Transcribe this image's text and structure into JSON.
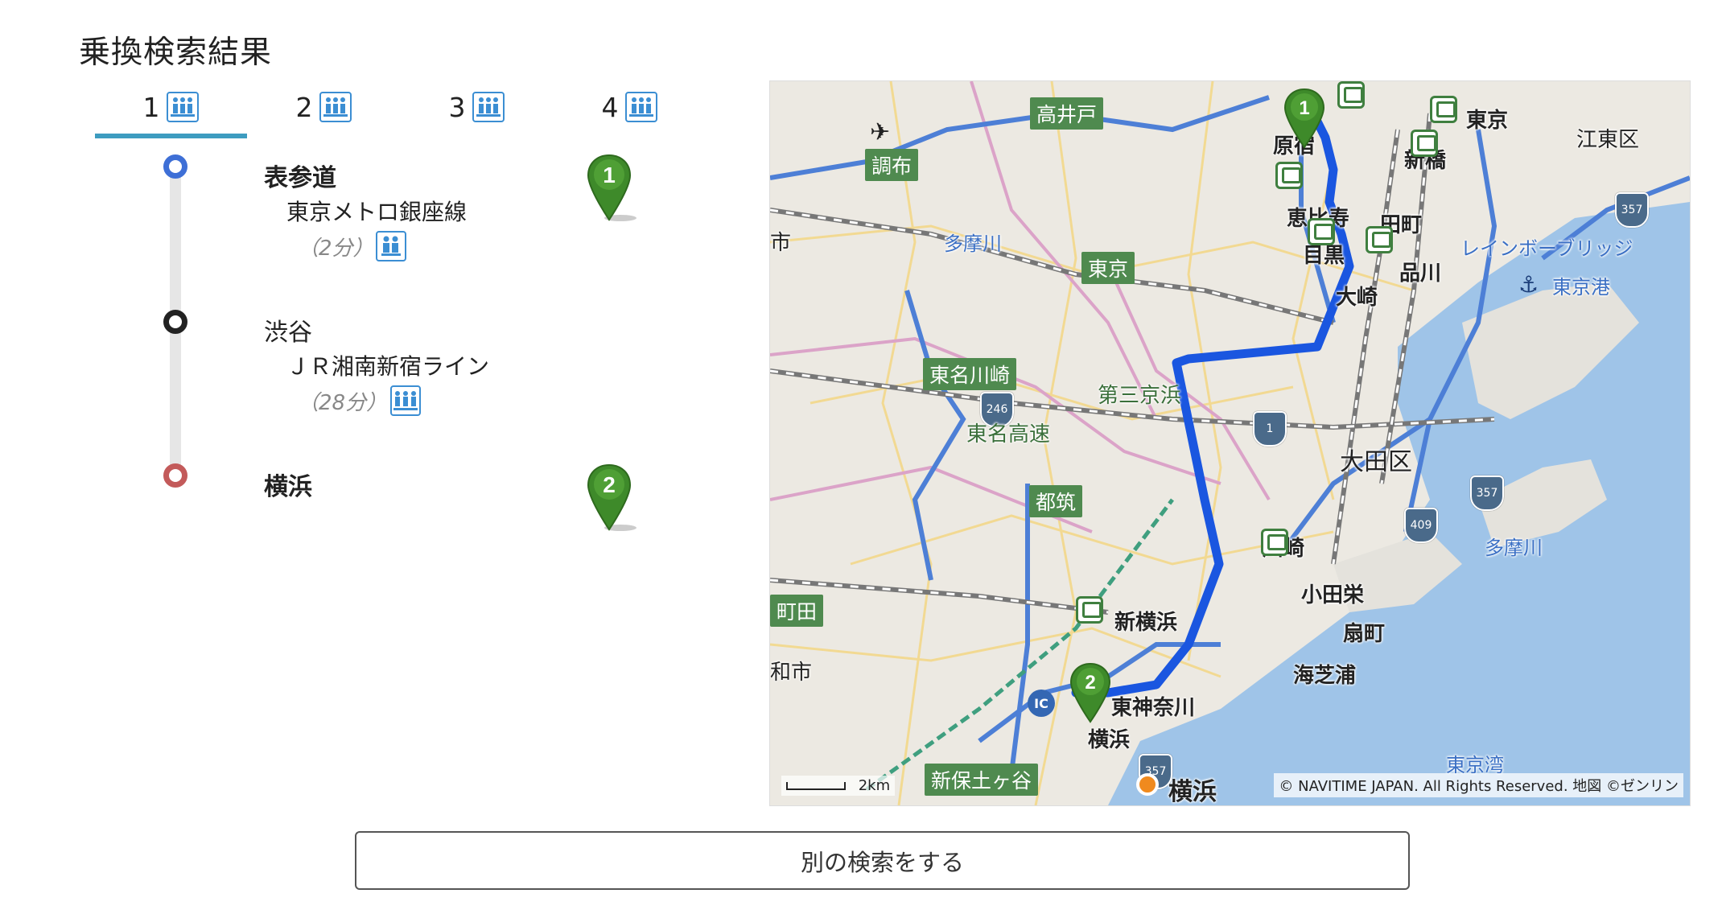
{
  "page": {
    "title": "乗換検索結果"
  },
  "tabs": [
    {
      "label": "1",
      "icon": "seat-icon"
    },
    {
      "label": "2",
      "icon": "seat-icon"
    },
    {
      "label": "3",
      "icon": "seat-icon"
    },
    {
      "label": "4",
      "icon": "seat-icon"
    }
  ],
  "route": {
    "start_station": "表参道",
    "start_marker": "1",
    "segment1_line": "東京メトロ銀座線",
    "segment1_duration": "（2分）",
    "transfer_station": "渋谷",
    "segment2_line": "ＪＲ湘南新宿ライン",
    "segment2_duration": "（28分）",
    "end_station": "横浜",
    "end_marker": "2"
  },
  "map": {
    "labels": {
      "koenji": "高井戸",
      "chofu": "調布",
      "tamagawa1": "多摩川",
      "tokyo_road": "東京",
      "tomei_kawasaki": "東名川崎",
      "tomei": "東名高速",
      "daisan_keihin": "第三京浜",
      "tsuzuki": "都筑",
      "harajuku": "原宿",
      "ebisu": "恵比寿",
      "meguro": "目黒",
      "tamachi": "田町",
      "shinagawa": "品川",
      "osaki": "大崎",
      "tokyo": "東京",
      "shinbashi": "新橋",
      "koto": "江東区",
      "rainbow": "レインボーブリッジ",
      "tokyo_port": "東京港",
      "ota": "大田区",
      "kawasaki": "川崎",
      "tamagawa2": "多摩川",
      "odasakae": "小田栄",
      "ogimachi": "扇町",
      "kaishiba": "海芝浦",
      "shinyokohama": "新横浜",
      "higashikanagawa": "東神奈川",
      "yokohama_st": "横浜",
      "yokohama": "横浜",
      "shinhodogaya": "新保土ヶ谷",
      "tokyo_bay": "東京湾",
      "machida": "町田",
      "washi": "和市",
      "shi": "市"
    },
    "shields": {
      "r246": "246",
      "r1": "1",
      "r357a": "357",
      "r357b": "357",
      "r409": "409",
      "r357c": "357"
    },
    "scale": "2km",
    "copyright": "© NAVITIME JAPAN. All Rights Reserved. 地図 ©ゼンリン",
    "marker1": "1",
    "marker2": "2"
  },
  "actions": {
    "search_again": "別の検索をする"
  }
}
